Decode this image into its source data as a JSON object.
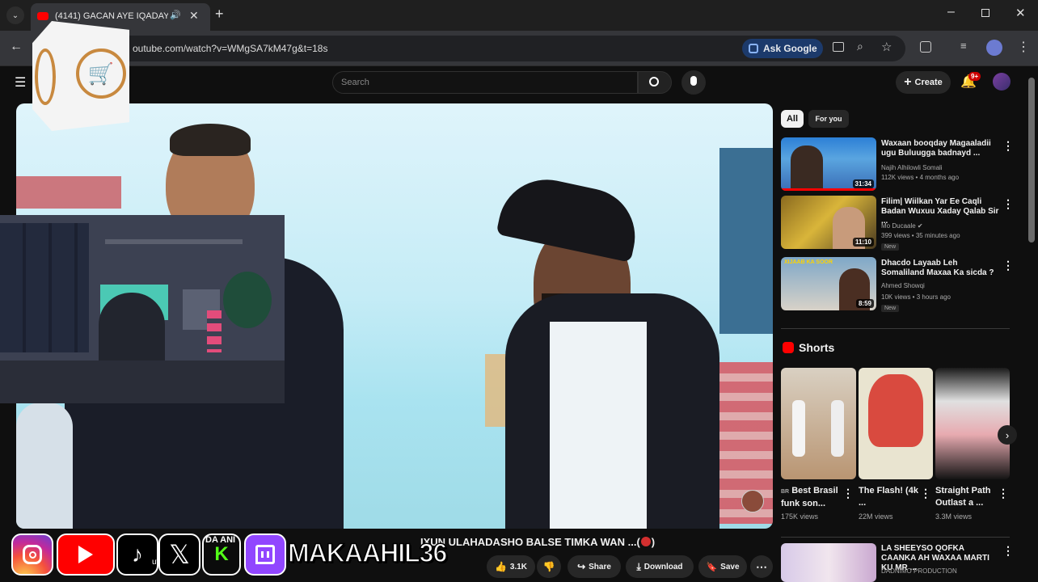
{
  "browser": {
    "tab_title": "(4141) GACAN AYE IQADAY",
    "url": "outube.com/watch?v=WMgSA7kM47g&t=18s",
    "ask_google": "Ask Google"
  },
  "youtube": {
    "search_placeholder": "Search",
    "create_label": "Create",
    "notif_count": "9+"
  },
  "chips": [
    "All",
    "For you"
  ],
  "video": {
    "title": "IXUN ULAHADASHO BALSE TIMKA WAN ...(",
    "title_end": ")"
  },
  "actions": {
    "likes": "3.1K",
    "share": "Share",
    "download": "Download",
    "save": "Save"
  },
  "recommended": [
    {
      "title": "Waxaan booqday Magaaladii ugu Buluugga badnayd ...",
      "channel": "Najih Alhilowli Somali",
      "meta": "112K views • 4 months ago",
      "duration": "31:34",
      "new": ""
    },
    {
      "title": "Filim| Wiilkan Yar Ee Caqli Badan Wuxuu Xaday Qalab Sir ...",
      "channel": "Mo Ducaale",
      "meta": "399 views • 35 minutes ago",
      "duration": "11:10",
      "new": "New"
    },
    {
      "title": "Dhacdo Layaab Leh Somaliland Maxaa Ka sicda ?",
      "channel": "Ahmed Showqi",
      "meta": "10K views • 3 hours ago",
      "duration": "8:59",
      "new": "New",
      "thumb_text": "XIJAAB KA SOOR"
    }
  ],
  "shorts": {
    "heading": "Shorts",
    "items": [
      {
        "title": "Best Brasil funk son...",
        "prefix": "BR",
        "views": "175K views"
      },
      {
        "title": "The Flash! (4k ...",
        "views": "22M views"
      },
      {
        "title": "Straight Path Outlast a ...",
        "views": "3.3M views"
      }
    ]
  },
  "bottom_rec": {
    "title": "LA SHEEYSO QOFKA CAANKA AH WAXAA MARTI KU MR ...",
    "channel": "DADNIMO PRODUCTION"
  },
  "overlay": {
    "handle": "MAKAAHIL36",
    "fragment1": "DA ANI",
    "fragment2": "ut"
  },
  "colors": {
    "accent_red": "#ff0000",
    "ask_google_bg": "#1c3a6b",
    "twitch": "#9146ff"
  }
}
